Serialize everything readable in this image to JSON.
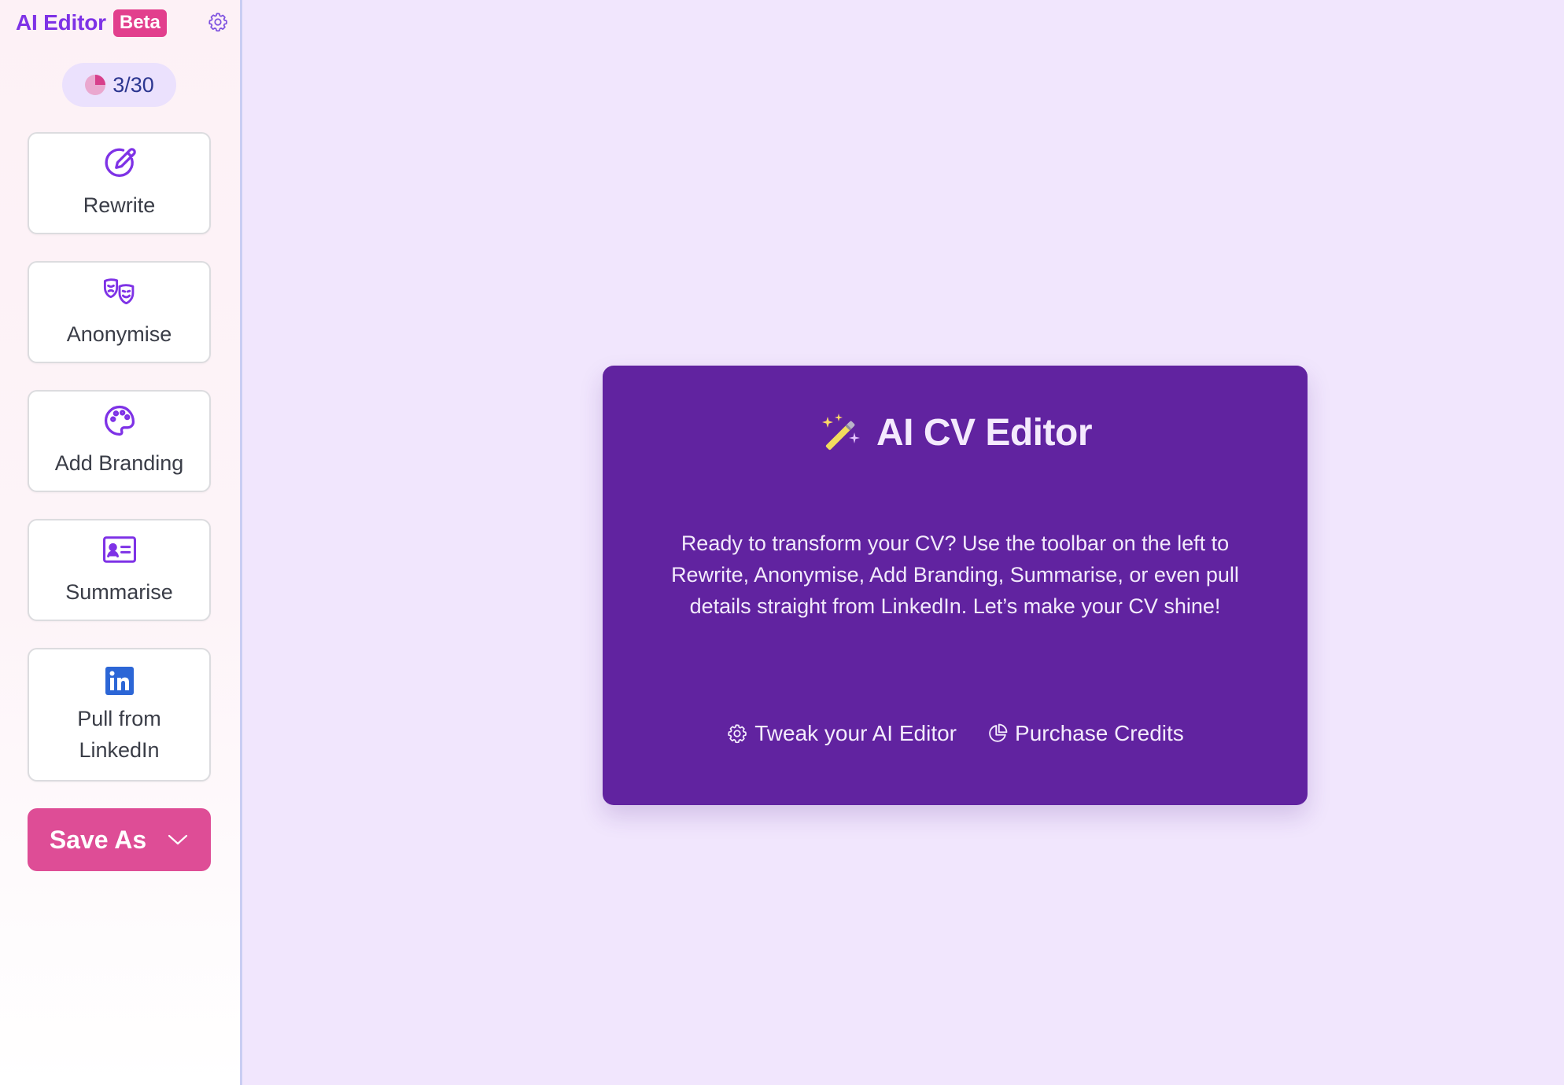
{
  "sidebar": {
    "brand_title": "AI Editor",
    "beta_label": "Beta",
    "credits": "3/30",
    "tools": [
      {
        "label": "Rewrite",
        "icon": "pencil-icon"
      },
      {
        "label": "Anonymise",
        "icon": "masks-icon"
      },
      {
        "label": "Add Branding",
        "icon": "palette-icon"
      },
      {
        "label": "Summarise",
        "icon": "id-card-icon"
      },
      {
        "label": "Pull from LinkedIn",
        "icon": "linkedin-icon"
      }
    ],
    "save_label": "Save As"
  },
  "card": {
    "title": "AI CV Editor",
    "description": "Ready to transform your CV? Use the toolbar on the left to Rewrite, Anonymise, Add Branding, Summarise, or even pull details straight from LinkedIn. Let’s make your CV shine!",
    "tweak_label": "Tweak your AI Editor",
    "purchase_label": "Purchase Credits"
  },
  "colors": {
    "accent_purple": "#7e32e6",
    "pink": "#de4d96",
    "card_bg": "#6123a0",
    "page_bg": "#f1e6fd"
  }
}
